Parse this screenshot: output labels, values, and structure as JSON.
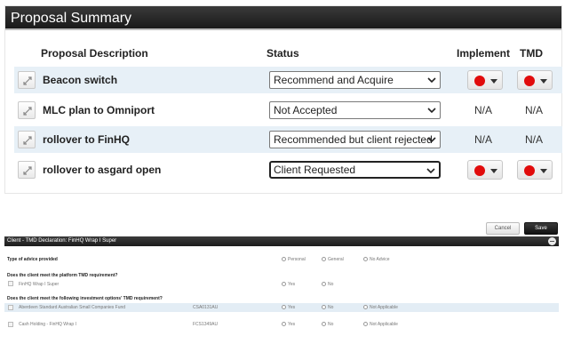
{
  "proposal_summary": {
    "title": "Proposal Summary",
    "columns": {
      "description": "Proposal Description",
      "status": "Status",
      "implement": "Implement",
      "tmd": "TMD"
    },
    "rows": [
      {
        "description": "Beacon switch",
        "status": "Recommend and Acquire",
        "implement": "dot",
        "tmd": "dot"
      },
      {
        "description": "MLC plan to Omniport",
        "status": "Not Accepted",
        "implement": "N/A",
        "tmd": "N/A"
      },
      {
        "description": "rollover to FinHQ",
        "status": "Recommended but client rejected",
        "implement": "N/A",
        "tmd": "N/A"
      },
      {
        "description": "rollover to asgard open",
        "status": "Client Requested",
        "implement": "dot",
        "tmd": "dot"
      }
    ],
    "dot_color": "#e10b0b"
  },
  "toolbar": {
    "cancel_label": "Cancel",
    "save_label": "Save"
  },
  "tmd_declaration": {
    "title": "Client - TMD Declaration: FinHQ Wrap I Super",
    "advice": {
      "label": "Type of advice provided",
      "options": [
        "Personal",
        "General",
        "No Advice"
      ]
    },
    "platform_question": "Does the client meet the platform TMD requirement?",
    "platform_item": {
      "name": "FinHQ Wrap I Super",
      "options": [
        "Yes",
        "No"
      ]
    },
    "investment_question": "Does the client meet the following investment options' TMD requirement?",
    "investments": [
      {
        "name": "Aberdeen Standard Australian Small Companies Fund",
        "code": "CSA0131AU",
        "options": [
          "Yes",
          "No",
          "Not Applicable"
        ]
      },
      {
        "name": "Cash Holding - FinHQ Wrap I",
        "code": "FCS1349AU",
        "options": [
          "Yes",
          "No",
          "Not Applicable"
        ]
      }
    ]
  }
}
